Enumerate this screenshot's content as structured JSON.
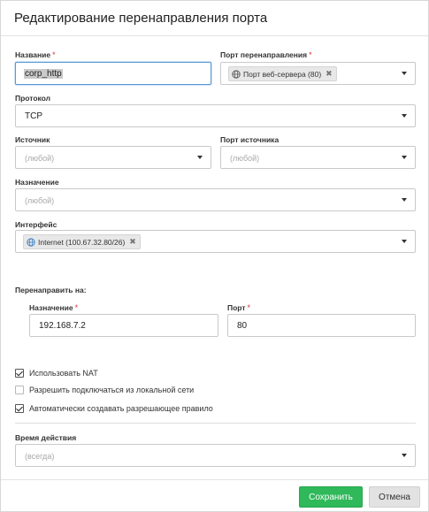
{
  "dialog": {
    "title": "Редактирование перенаправления порта"
  },
  "fields": {
    "name": {
      "label": "Название",
      "required_mark": "*",
      "value": "corp_http"
    },
    "redirect_port": {
      "label": "Порт перенаправления",
      "required_mark": "*",
      "chip": "Порт веб-сервера (80)",
      "chip_remove": "✖"
    },
    "protocol": {
      "label": "Протокол",
      "value": "TCP"
    },
    "source": {
      "label": "Источник",
      "placeholder": "(любой)"
    },
    "source_port": {
      "label": "Порт источника",
      "placeholder": "(любой)"
    },
    "destination": {
      "label": "Назначение",
      "placeholder": "(любой)"
    },
    "interface": {
      "label": "Интерфейс",
      "chip": "Internet (100.67.32.80/26)",
      "chip_remove": "✖"
    }
  },
  "redirect_to": {
    "section_label": "Перенаправить на:",
    "destination": {
      "label": "Назначение",
      "required_mark": "*",
      "value": "192.168.7.2"
    },
    "port": {
      "label": "Порт",
      "required_mark": "*",
      "value": "80"
    }
  },
  "options": [
    {
      "label": "Использовать NAT",
      "checked": true
    },
    {
      "label": "Разрешить подключаться из локальной сети",
      "checked": false
    },
    {
      "label": "Автоматически создавать разрешающее правило",
      "checked": true
    }
  ],
  "schedule": {
    "label": "Время действия",
    "placeholder": "(всегда)"
  },
  "buttons": {
    "save": "Сохранить",
    "cancel": "Отмена"
  },
  "colors": {
    "save_button": "#2fb95a",
    "required_mark": "#e0322f",
    "focus_border": "#5a9ad6"
  },
  "icons": {
    "chip_icon": "globe-icon",
    "dropdown": "caret-down-icon",
    "remove": "remove-chip-icon"
  }
}
